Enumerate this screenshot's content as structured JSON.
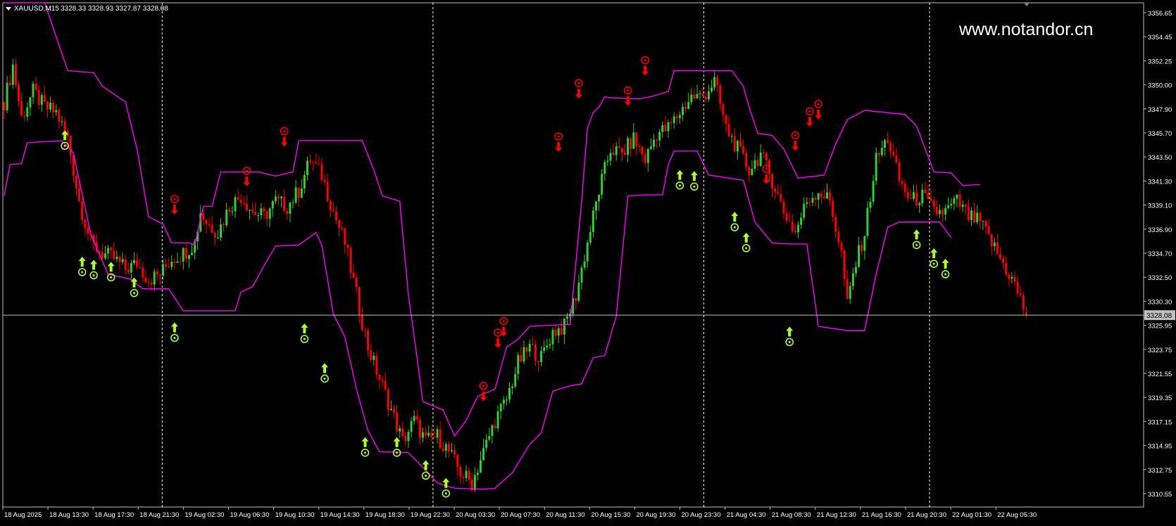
{
  "header": {
    "symbol_label": "XAUUSD,M15",
    "ohlc_label": "3328.33 3328.93 3327.87 3328.08"
  },
  "watermark": "www.notandor.cn",
  "current_price_label": "3328.08",
  "colors": {
    "background": "#000000",
    "frame": "#c0c0c0",
    "bull_candle": "#32cd32",
    "bear_candle": "#ff0000",
    "channel": "#ff00ff",
    "buy_signal": "#adff2f",
    "sell_signal": "#ff0000",
    "price_line": "#c0c0c0",
    "text": "#ffffff"
  },
  "chart_data": {
    "type": "candlestick",
    "title": "XAUUSD,M15",
    "ylim": [
      3309.7,
      3358.0
    ],
    "y_ticks": [
      "3356.65",
      "3354.45",
      "3352.25",
      "3350.00",
      "3347.90",
      "3345.70",
      "3343.50",
      "3341.30",
      "3339.10",
      "3336.90",
      "3334.70",
      "3332.50",
      "3330.30",
      "3328.08",
      "3325.95",
      "3323.75",
      "3321.55",
      "3319.35",
      "3317.15",
      "3314.95",
      "3312.75",
      "3310.55"
    ],
    "x_ticks": [
      "18 Aug 2025",
      "18 Aug 13:30",
      "18 Aug 17:30",
      "18 Aug 21:30",
      "19 Aug 02:30",
      "19 Aug 06:30",
      "19 Aug 10:30",
      "19 Aug 14:30",
      "19 Aug 18:30",
      "19 Aug 22:30",
      "20 Aug 03:30",
      "20 Aug 07:30",
      "20 Aug 11:30",
      "20 Aug 15:30",
      "20 Aug 19:30",
      "20 Aug 23:30",
      "21 Aug 04:30",
      "21 Aug 08:30",
      "21 Aug 12:30",
      "21 Aug 16:30",
      "21 Aug 20:30",
      "22 Aug 01:30",
      "22 Aug 05:30"
    ],
    "day_separators_after": [
      "18 Aug 21:30",
      "19 Aug 22:30",
      "20 Aug 23:30",
      "21 Aug 20:30"
    ],
    "current_price": 3328.08,
    "last_bar": {
      "open": 3328.33,
      "high": 3328.93,
      "low": 3327.87,
      "close": 3328.08
    },
    "close_path": [
      [
        0,
        3348.5
      ],
      [
        3,
        3352.0
      ],
      [
        6,
        3347.0
      ],
      [
        10,
        3349.5
      ],
      [
        14,
        3348.0
      ],
      [
        18,
        3347.5
      ],
      [
        22,
        3345.0
      ],
      [
        26,
        3339.0
      ],
      [
        30,
        3335.0
      ],
      [
        34,
        3334.0
      ],
      [
        38,
        3333.5
      ],
      [
        42,
        3332.5
      ],
      [
        46,
        3333.0
      ],
      [
        50,
        3331.5
      ],
      [
        54,
        3332.0
      ],
      [
        58,
        3333.5
      ],
      [
        62,
        3334.0
      ],
      [
        66,
        3335.0
      ],
      [
        68,
        3338.0
      ],
      [
        70,
        3337.0
      ],
      [
        74,
        3336.0
      ],
      [
        78,
        3338.5
      ],
      [
        82,
        3339.5
      ],
      [
        86,
        3338.0
      ],
      [
        90,
        3337.5
      ],
      [
        94,
        3339.0
      ],
      [
        98,
        3338.5
      ],
      [
        102,
        3340.0
      ],
      [
        106,
        3343.0
      ],
      [
        110,
        3341.5
      ],
      [
        114,
        3338.0
      ],
      [
        118,
        3335.0
      ],
      [
        122,
        3330.0
      ],
      [
        126,
        3325.0
      ],
      [
        130,
        3322.0
      ],
      [
        134,
        3319.0
      ],
      [
        138,
        3316.0
      ],
      [
        142,
        3318.0
      ],
      [
        146,
        3316.0
      ],
      [
        150,
        3316.5
      ],
      [
        154,
        3315.0
      ],
      [
        158,
        3313.0
      ],
      [
        162,
        3312.0
      ],
      [
        166,
        3315.0
      ],
      [
        170,
        3318.0
      ],
      [
        174,
        3320.0
      ],
      [
        178,
        3323.5
      ],
      [
        182,
        3325.0
      ],
      [
        186,
        3324.0
      ],
      [
        190,
        3326.5
      ],
      [
        194,
        3327.0
      ],
      [
        198,
        3330.0
      ],
      [
        202,
        3335.0
      ],
      [
        206,
        3340.0
      ],
      [
        210,
        3344.0
      ],
      [
        214,
        3343.5
      ],
      [
        218,
        3345.0
      ],
      [
        222,
        3343.0
      ],
      [
        226,
        3345.5
      ],
      [
        230,
        3346.0
      ],
      [
        234,
        3347.5
      ],
      [
        238,
        3349.0
      ],
      [
        242,
        3349.0
      ],
      [
        246,
        3350.5
      ],
      [
        250,
        3346.0
      ],
      [
        254,
        3344.0
      ],
      [
        258,
        3342.0
      ],
      [
        262,
        3343.5
      ],
      [
        266,
        3341.0
      ],
      [
        270,
        3338.0
      ],
      [
        274,
        3336.0
      ],
      [
        278,
        3339.0
      ],
      [
        282,
        3340.0
      ],
      [
        286,
        3339.0
      ],
      [
        290,
        3334.0
      ],
      [
        292,
        3329.0
      ],
      [
        294,
        3332.0
      ],
      [
        298,
        3336.0
      ],
      [
        302,
        3343.0
      ],
      [
        306,
        3345.0
      ],
      [
        310,
        3341.0
      ],
      [
        314,
        3339.0
      ],
      [
        318,
        3339.5
      ],
      [
        322,
        3338.0
      ],
      [
        326,
        3338.0
      ],
      [
        330,
        3339.0
      ],
      [
        334,
        3337.5
      ],
      [
        338,
        3337.0
      ],
      [
        342,
        3335.0
      ],
      [
        346,
        3333.0
      ],
      [
        350,
        3331.0
      ],
      [
        354,
        3328.08
      ]
    ],
    "upper_channel": [
      [
        0,
        3365.0
      ],
      [
        14,
        3361.0
      ],
      [
        22,
        3351.5
      ],
      [
        31,
        3351.3
      ],
      [
        34,
        3350.0
      ],
      [
        42,
        3348.5
      ],
      [
        46,
        3344.0
      ],
      [
        50,
        3337.5
      ],
      [
        55,
        3336.8
      ],
      [
        58,
        3335.0
      ],
      [
        64,
        3335.0
      ],
      [
        66,
        3334.8
      ],
      [
        69,
        3338.5
      ],
      [
        72,
        3338.5
      ],
      [
        75,
        3341.8
      ],
      [
        88,
        3341.8
      ],
      [
        94,
        3341.4
      ],
      [
        100,
        3341.8
      ],
      [
        102,
        3344.8
      ],
      [
        124,
        3344.8
      ],
      [
        128,
        3342.0
      ],
      [
        131,
        3339.5
      ],
      [
        137,
        3339.0
      ],
      [
        140,
        3330.0
      ],
      [
        143,
        3324.0
      ],
      [
        145,
        3319.8
      ],
      [
        152,
        3319.0
      ],
      [
        156,
        3316.5
      ],
      [
        160,
        3318.0
      ],
      [
        164,
        3320.3
      ],
      [
        170,
        3321.0
      ],
      [
        174,
        3325.0
      ],
      [
        178,
        3325.8
      ],
      [
        182,
        3327.0
      ],
      [
        196,
        3327.2
      ],
      [
        200,
        3339.0
      ],
      [
        202,
        3346.0
      ],
      [
        204,
        3347.5
      ],
      [
        206,
        3348.0
      ],
      [
        208,
        3349.0
      ],
      [
        210,
        3348.9
      ],
      [
        220,
        3348.8
      ],
      [
        224,
        3349.0
      ],
      [
        230,
        3349.5
      ],
      [
        232,
        3351.5
      ],
      [
        252,
        3351.5
      ],
      [
        256,
        3350.0
      ],
      [
        258,
        3348.0
      ],
      [
        261,
        3345.5
      ],
      [
        266,
        3345.3
      ],
      [
        270,
        3344.0
      ],
      [
        275,
        3341.2
      ],
      [
        284,
        3341.5
      ],
      [
        288,
        3344.5
      ],
      [
        292,
        3346.8
      ],
      [
        298,
        3347.7
      ],
      [
        312,
        3347.3
      ],
      [
        316,
        3346.2
      ],
      [
        322,
        3341.8
      ],
      [
        328,
        3341.7
      ],
      [
        332,
        3340.5
      ],
      [
        338,
        3340.6
      ]
    ],
    "lower_channel": [
      [
        0,
        3339.5
      ],
      [
        2,
        3342.5
      ],
      [
        6,
        3342.6
      ],
      [
        8,
        3344.6
      ],
      [
        20,
        3344.8
      ],
      [
        24,
        3343.6
      ],
      [
        30,
        3335.8
      ],
      [
        36,
        3332.0
      ],
      [
        44,
        3331.5
      ],
      [
        48,
        3330.6
      ],
      [
        57,
        3330.6
      ],
      [
        62,
        3328.5
      ],
      [
        80,
        3328.5
      ],
      [
        82,
        3330.3
      ],
      [
        86,
        3330.8
      ],
      [
        90,
        3332.8
      ],
      [
        94,
        3334.7
      ],
      [
        102,
        3334.8
      ],
      [
        108,
        3336.0
      ],
      [
        110,
        3334.8
      ],
      [
        114,
        3328.2
      ],
      [
        118,
        3326.0
      ],
      [
        122,
        3321.0
      ],
      [
        126,
        3317.0
      ],
      [
        130,
        3315.0
      ],
      [
        140,
        3314.9
      ],
      [
        146,
        3313.2
      ],
      [
        150,
        3312.0
      ],
      [
        156,
        3311.5
      ],
      [
        166,
        3311.4
      ],
      [
        170,
        3311.5
      ],
      [
        176,
        3313.0
      ],
      [
        182,
        3315.7
      ],
      [
        186,
        3316.8
      ],
      [
        190,
        3320.8
      ],
      [
        196,
        3321.3
      ],
      [
        200,
        3321.5
      ],
      [
        204,
        3324.0
      ],
      [
        208,
        3324.2
      ],
      [
        212,
        3328.0
      ],
      [
        216,
        3339.5
      ],
      [
        222,
        3339.6
      ],
      [
        228,
        3339.6
      ],
      [
        230,
        3342.5
      ],
      [
        232,
        3343.8
      ],
      [
        240,
        3343.8
      ],
      [
        244,
        3341.5
      ],
      [
        256,
        3341.0
      ],
      [
        260,
        3337.0
      ],
      [
        266,
        3335.0
      ],
      [
        272,
        3334.9
      ],
      [
        278,
        3334.9
      ],
      [
        282,
        3327.0
      ],
      [
        292,
        3326.6
      ],
      [
        298,
        3326.6
      ],
      [
        302,
        3332.0
      ],
      [
        306,
        3336.5
      ],
      [
        310,
        3337.0
      ],
      [
        324,
        3337.0
      ],
      [
        328,
        3335.5
      ]
    ],
    "buy_signals": [
      [
        21,
        3344.3
      ],
      [
        27,
        3332.2
      ],
      [
        31,
        3331.9
      ],
      [
        37,
        3331.7
      ],
      [
        45,
        3330.2
      ],
      [
        59,
        3325.9
      ],
      [
        104,
        3325.8
      ],
      [
        111,
        3322.0
      ],
      [
        125,
        3314.9
      ],
      [
        136,
        3314.9
      ],
      [
        146,
        3312.7
      ],
      [
        153,
        3311.0
      ],
      [
        234,
        3340.5
      ],
      [
        239,
        3340.4
      ],
      [
        253,
        3336.5
      ],
      [
        257,
        3334.5
      ],
      [
        272,
        3325.5
      ],
      [
        316,
        3334.8
      ],
      [
        322,
        3333.0
      ],
      [
        326,
        3332.0
      ]
    ],
    "sell_signals": [
      [
        59,
        3339.2
      ],
      [
        84,
        3341.9
      ],
      [
        97,
        3345.7
      ],
      [
        166,
        3321.3
      ],
      [
        171,
        3326.4
      ],
      [
        173,
        3327.5
      ],
      [
        192,
        3345.2
      ],
      [
        199,
        3350.3
      ],
      [
        216,
        3349.6
      ],
      [
        222,
        3352.5
      ],
      [
        264,
        3342.1
      ],
      [
        274,
        3345.3
      ],
      [
        279,
        3347.6
      ],
      [
        282,
        3348.3
      ]
    ]
  }
}
